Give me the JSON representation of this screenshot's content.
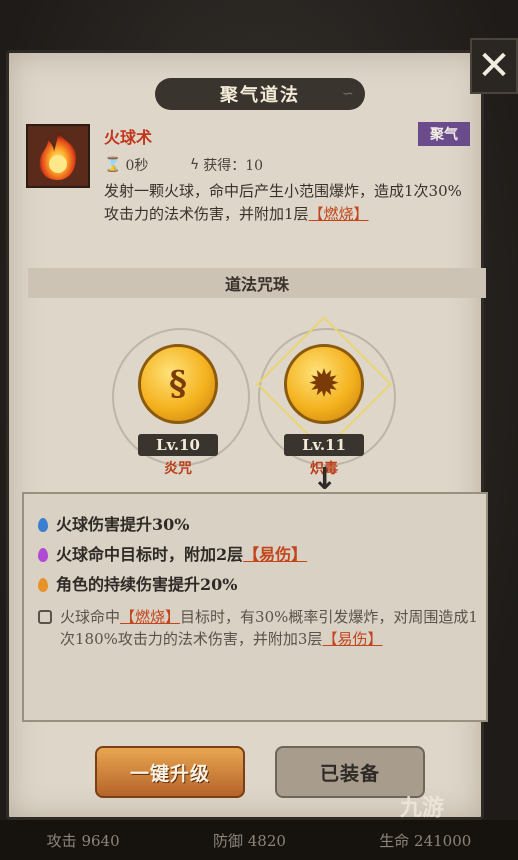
{
  "dialog": {
    "title": "聚气道法",
    "close_icon": "close-x-icon"
  },
  "skill": {
    "icon": "fireball-icon",
    "name": "火球术",
    "tag": "聚气",
    "cooldown": "0秒",
    "gain": "获得：10",
    "desc_part1": "发射一颗火球，命中后产生小范围爆炸，造成1次30%攻击力的法术伤害，并附加1层",
    "desc_keyword": "【燃烧】"
  },
  "section": {
    "title": "道法咒珠"
  },
  "orbs": [
    {
      "level": "Lv.10",
      "name": "炎咒",
      "glyph": "§"
    },
    {
      "level": "Lv.11",
      "name": "炽毒",
      "glyph": "✹"
    }
  ],
  "effects": [
    {
      "text": "火球伤害提升30%",
      "color": "#3a7fd0"
    },
    {
      "text_part1": "火球命中目标时，附加2层",
      "keyword": "【易伤】",
      "color": "#b24ad8"
    },
    {
      "text": "角色的持续伤害提升20%",
      "color": "#e8932a"
    }
  ],
  "locked_effect": {
    "prefix": "火球命中",
    "keyword1": "【燃烧】",
    "middle": "目标时，有30%概率引发爆炸，对周围造成1次180%攻击力的法术伤害，并附加3层",
    "keyword2": "【易伤】"
  },
  "buttons": {
    "upgrade": "一键升级",
    "equipped": "已装备"
  },
  "stats": {
    "attack": "攻击 9640",
    "defense": "防御 4820",
    "hp": "生命 241000"
  },
  "watermark": "九游"
}
